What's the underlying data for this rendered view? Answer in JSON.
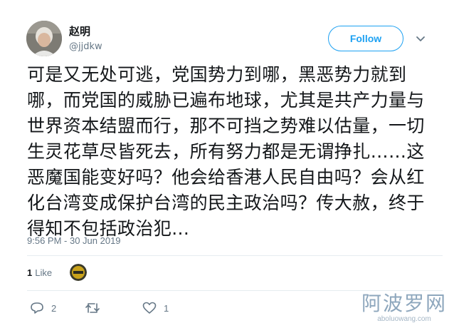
{
  "author": {
    "name": "赵明",
    "handle": "@jjdkw"
  },
  "header": {
    "follow_label": "Follow"
  },
  "tweet": {
    "text": "可是又无处可逃，党国势力到哪，黑恶势力就到哪，而党国的威胁已遍布地球，尤其是共产力量与世界资本结盟而行，那不可挡之势难以估量，一切生灵花草尽皆死去，所有努力都是无谓挣扎……这恶魔国能变好吗？他会给香港人民自由吗？会从红化台湾变成保护台湾的民主政治吗？传大赦，终于得知不包括政治犯...",
    "timestamp": "9:56 PM - 30 Jun 2019"
  },
  "stats": {
    "like_count": "1",
    "like_label": "Like"
  },
  "actions": {
    "reply_count": "2",
    "retweet_count": "",
    "like_count": "1"
  },
  "watermark": {
    "text": "阿波罗网",
    "url": "aboluowang.com"
  },
  "colors": {
    "accent": "#1da1f2",
    "text": "#14171a",
    "muted": "#657786",
    "divider": "#e6ecf0"
  },
  "icons": {
    "caret": "chevron-down-icon",
    "reply": "reply-icon",
    "retweet": "retweet-icon",
    "like": "heart-icon"
  }
}
